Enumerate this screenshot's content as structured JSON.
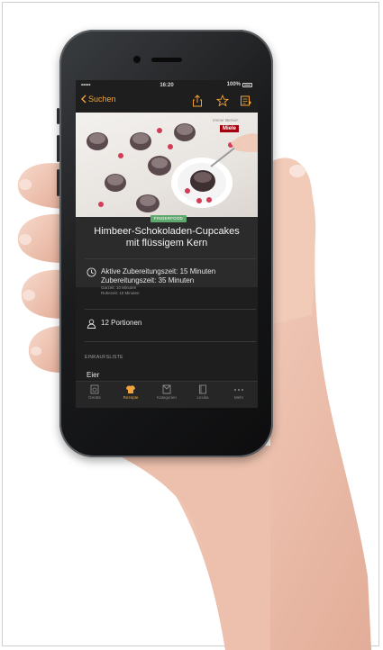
{
  "statusbar": {
    "signal": "•••••",
    "time": "16:20",
    "battery": "100%"
  },
  "navbar": {
    "back_label": "Suchen"
  },
  "hero": {
    "brand_tagline": "Immer Besser.",
    "brand_logo": "Miele"
  },
  "recipe": {
    "badge": "FINGERFOOD",
    "title_line1": "Himbeer-Schokoladen-Cupcakes",
    "title_line2": "mit flüssigem Kern",
    "active_time": "Aktive Zubereitungszeit: 15 Minuten",
    "total_time": "Zubereitungszeit: 35 Minuten",
    "baking_time": "Garzeit: 10 Minuten",
    "rest_time": "Ruhezeit: 10 Minuten",
    "portions": "12 Portionen"
  },
  "shopping": {
    "title": "EINKAUFSLISTE",
    "items": [
      "Eier"
    ]
  },
  "tabbar": {
    "tabs": [
      {
        "label": "Geräte",
        "active": false
      },
      {
        "label": "Rezepte",
        "active": true
      },
      {
        "label": "Kategorien",
        "active": false
      },
      {
        "label": "Lexika",
        "active": false
      },
      {
        "label": "Mehr",
        "active": false
      }
    ]
  },
  "colors": {
    "accent": "#f2a33a",
    "badge": "#5fa86e",
    "screen_bg": "#1e1e1f"
  }
}
